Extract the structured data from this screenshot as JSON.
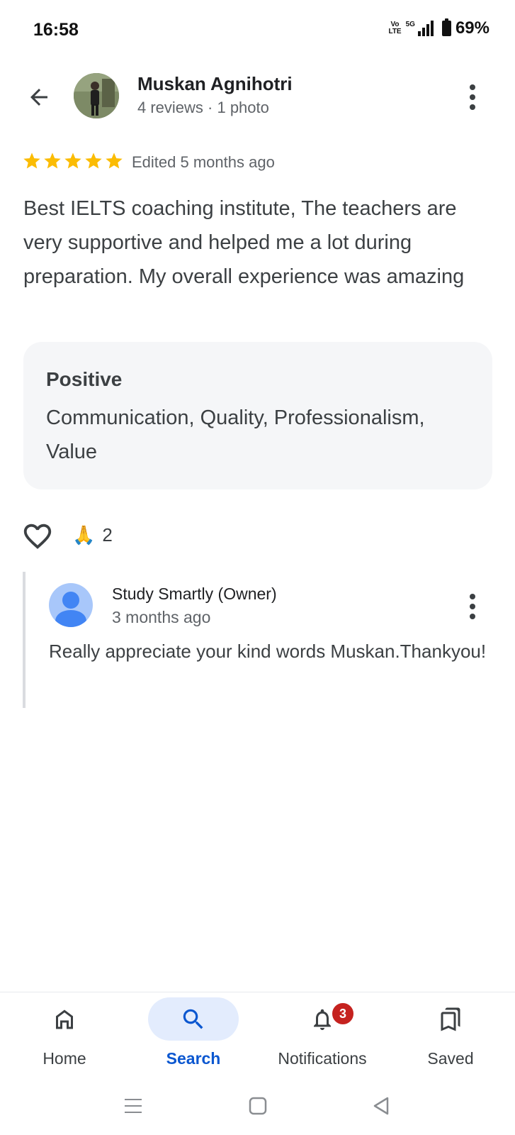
{
  "status_bar": {
    "time": "16:58",
    "volte_top": "Vo",
    "volte_bottom": "LTE",
    "network": "5G",
    "battery": "69%"
  },
  "reviewer": {
    "name": "Muskan Agnihotri",
    "meta": "4 reviews · 1 photo"
  },
  "review": {
    "rating": 5,
    "edited": "Edited 5 months ago",
    "text": "Best IELTS coaching institute, The teachers are very supportive and helped me a lot during preparation. My overall experience was amazing",
    "attributes_title": "Positive",
    "attributes": "Communication, Quality, Professionalism, Value",
    "reaction_emoji": "🙏",
    "reaction_count": "2"
  },
  "owner_reply": {
    "name": "Study Smartly (Owner)",
    "time": "3 months ago",
    "text": "Really appreciate your kind words Muskan.Thankyou!"
  },
  "bottom_nav": {
    "items": [
      {
        "label": "Home",
        "icon": "home-icon"
      },
      {
        "label": "Search",
        "icon": "search-icon",
        "active": true
      },
      {
        "label": "Notifications",
        "icon": "bell-icon",
        "badge": "3"
      },
      {
        "label": "Saved",
        "icon": "bookmarks-icon"
      }
    ]
  },
  "colors": {
    "accent": "#0b57d0",
    "star": "#fbbc04",
    "badge": "#c5221f",
    "card_bg": "#f5f6f8",
    "active_pill": "#e3ecfd"
  }
}
